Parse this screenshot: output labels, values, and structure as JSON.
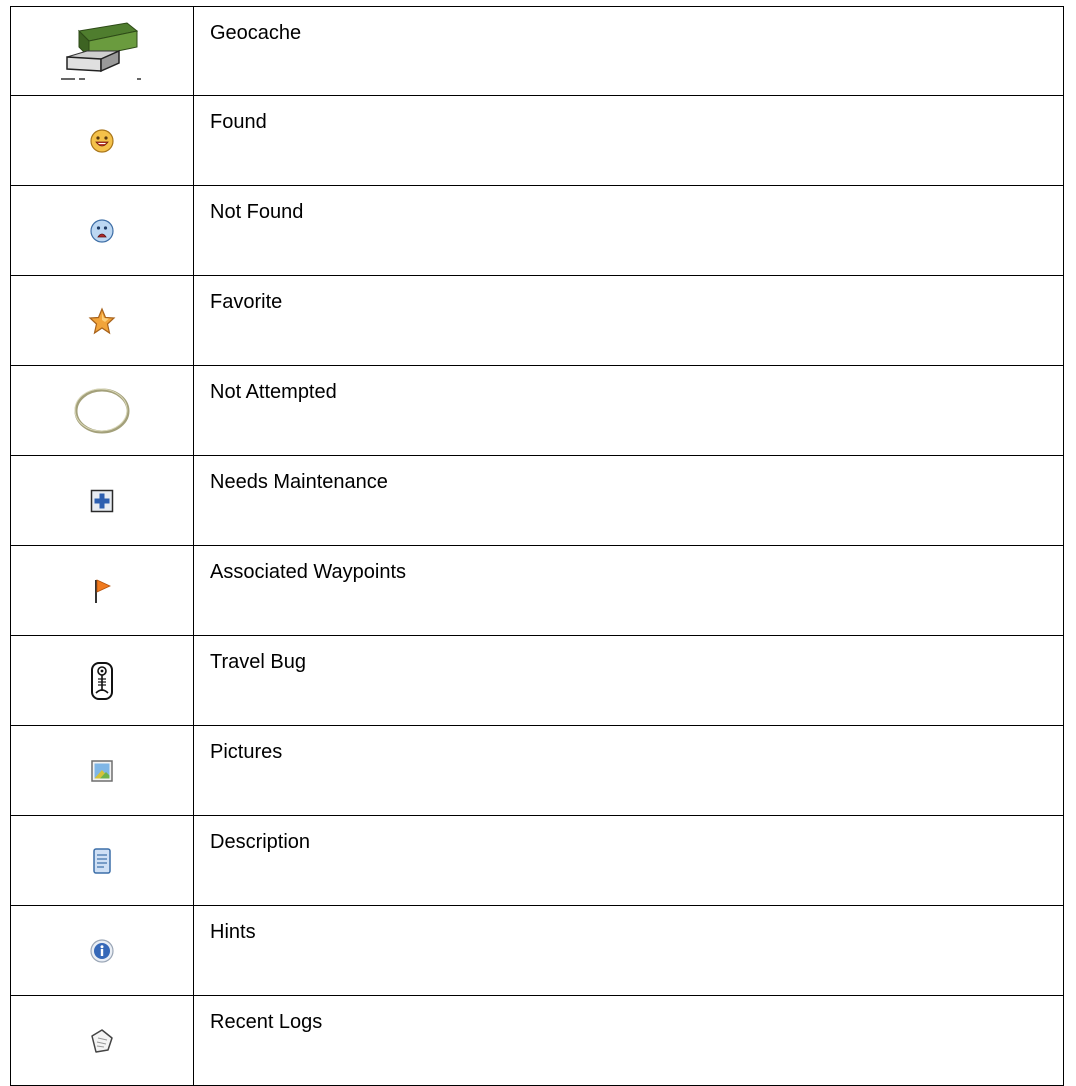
{
  "legend": {
    "rows": [
      {
        "icon": "geocache-box-icon",
        "label": "Geocache"
      },
      {
        "icon": "found-smiley-icon",
        "label": "Found"
      },
      {
        "icon": "not-found-sad-icon",
        "label": "Not Found"
      },
      {
        "icon": "star-icon",
        "label": "Favorite"
      },
      {
        "icon": "empty-circle-icon",
        "label": "Not Attempted"
      },
      {
        "icon": "medical-cross-icon",
        "label": "Needs Maintenance"
      },
      {
        "icon": "flag-icon",
        "label": "Associated Waypoints"
      },
      {
        "icon": "travel-bug-icon",
        "label": "Travel Bug"
      },
      {
        "icon": "picture-icon",
        "label": "Pictures"
      },
      {
        "icon": "document-icon",
        "label": "Description"
      },
      {
        "icon": "info-icon",
        "label": "Hints"
      },
      {
        "icon": "log-page-icon",
        "label": "Recent Logs"
      }
    ]
  }
}
